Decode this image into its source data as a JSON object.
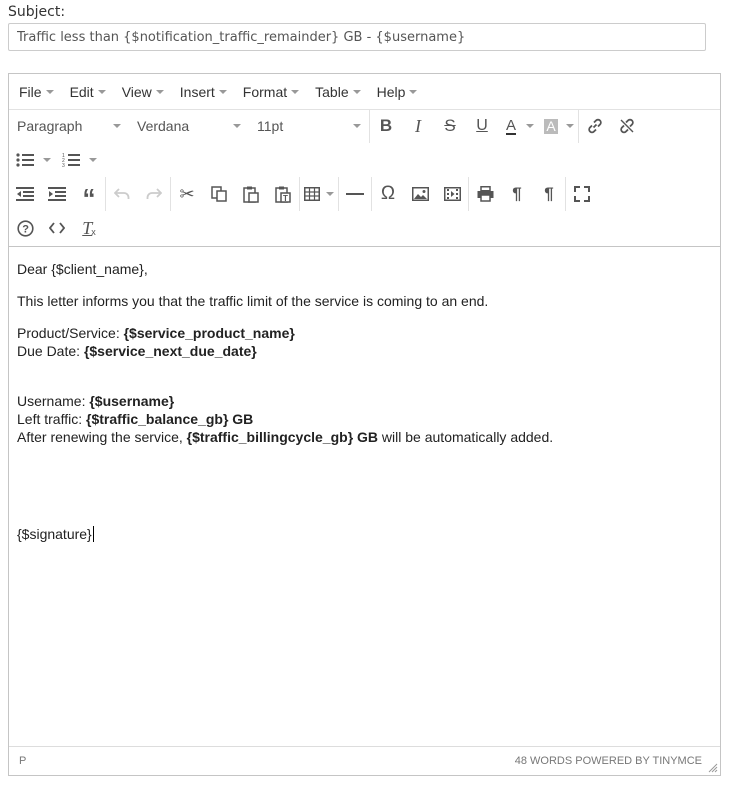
{
  "subject": {
    "label": "Subject:",
    "value": "Traffic less than {$notification_traffic_remainder} GB - {$username}"
  },
  "menubar": {
    "file": "File",
    "edit": "Edit",
    "view": "View",
    "insert": "Insert",
    "format": "Format",
    "table": "Table",
    "help": "Help"
  },
  "toolbar": {
    "block_format": "Paragraph",
    "font_family": "Verdana",
    "font_size": "11pt"
  },
  "content": {
    "greeting": "Dear {$client_name},",
    "intro": "This letter informs you that the traffic limit of the service is coming to an end.",
    "product_label": "Product/Service: ",
    "product_value": "{$service_product_name}",
    "due_label": "Due Date: ",
    "due_value": "{$service_next_due_date}",
    "username_label": "Username: ",
    "username_value": "{$username}",
    "left_label": "Left traffic: ",
    "left_value": "{$traffic_balance_gb} GB",
    "renew_prefix": "After renewing the service, ",
    "renew_value": "{$traffic_billingcycle_gb} GB",
    "renew_suffix": " will be automatically added.",
    "signature": "{$signature}"
  },
  "statusbar": {
    "path": "P",
    "info": "48 WORDS POWERED BY TINYMCE"
  }
}
